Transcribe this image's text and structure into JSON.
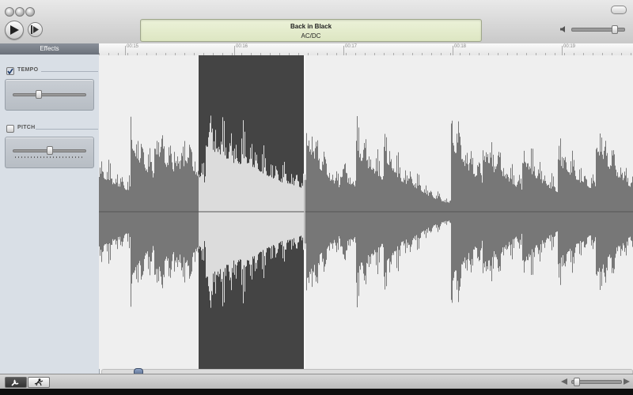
{
  "window": {
    "controls": [
      "close-button",
      "minimize-button",
      "zoom-button"
    ]
  },
  "toolbar": {
    "play_icon": "play-icon",
    "play_selection_icon": "play-selection-icon",
    "volume_level": 0.9
  },
  "now_playing": {
    "title": "Back in Black",
    "artist": "AC/DC"
  },
  "sidebar": {
    "header": "Effects",
    "effects": [
      {
        "label": "TEMPO",
        "checked": true,
        "slider_value": 0.33
      },
      {
        "label": "PITCH",
        "checked": false,
        "slider_value": 0.5
      }
    ]
  },
  "ruler": {
    "labels": [
      "00:15",
      "00:16",
      "00:17",
      "00:18",
      "00:19"
    ]
  },
  "waveform": {
    "selection": {
      "start_fraction": 0.187,
      "end_fraction": 0.384
    },
    "colors": {
      "wave": "#777777",
      "selection_bg": "#444444",
      "selected_wave": "#dcdcdc",
      "background": "#efefef"
    }
  },
  "scroll": {
    "position": 0.06
  },
  "bottombar": {
    "modes": [
      {
        "icon": "wrench-icon",
        "active": true
      },
      {
        "icon": "running-man-icon",
        "active": false
      }
    ],
    "zoom_level": 0.1
  }
}
